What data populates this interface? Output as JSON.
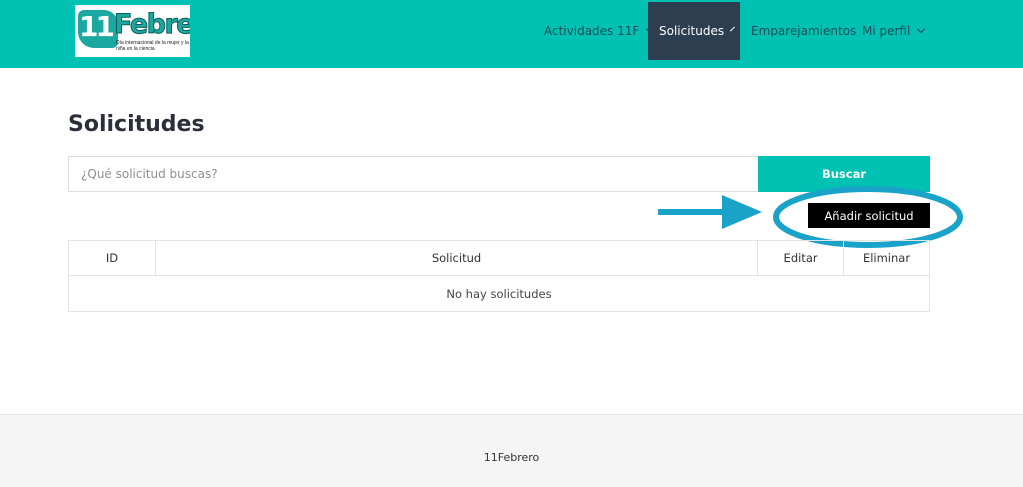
{
  "brand": {
    "logo_number": "11",
    "logo_word": "Febrero",
    "logo_tagline": "Día internacional de la mujer y la niña en la ciencia"
  },
  "nav": {
    "items": [
      {
        "label": "Actividades 11F",
        "has_dropdown": true,
        "active": false
      },
      {
        "label": "Solicitudes",
        "has_dropdown": true,
        "active": true
      },
      {
        "label": "Emparejamientos",
        "has_dropdown": false,
        "active": false
      },
      {
        "label": "Mi perfil",
        "has_dropdown": true,
        "active": false
      }
    ]
  },
  "main": {
    "title": "Solicitudes",
    "search": {
      "placeholder": "¿Qué solicitud buscas?",
      "value": "",
      "button_label": "Buscar"
    },
    "add_button_label": "Añadir solicitud",
    "table": {
      "columns": [
        "ID",
        "Solicitud",
        "Editar",
        "Eliminar"
      ],
      "empty_message": "No hay solicitudes"
    }
  },
  "footer": {
    "text": "11Febrero"
  },
  "colors": {
    "accent": "#00c1b2",
    "nav_active": "#2c3e50",
    "annotation": "#1aa3c8",
    "add_button": "#000000"
  }
}
